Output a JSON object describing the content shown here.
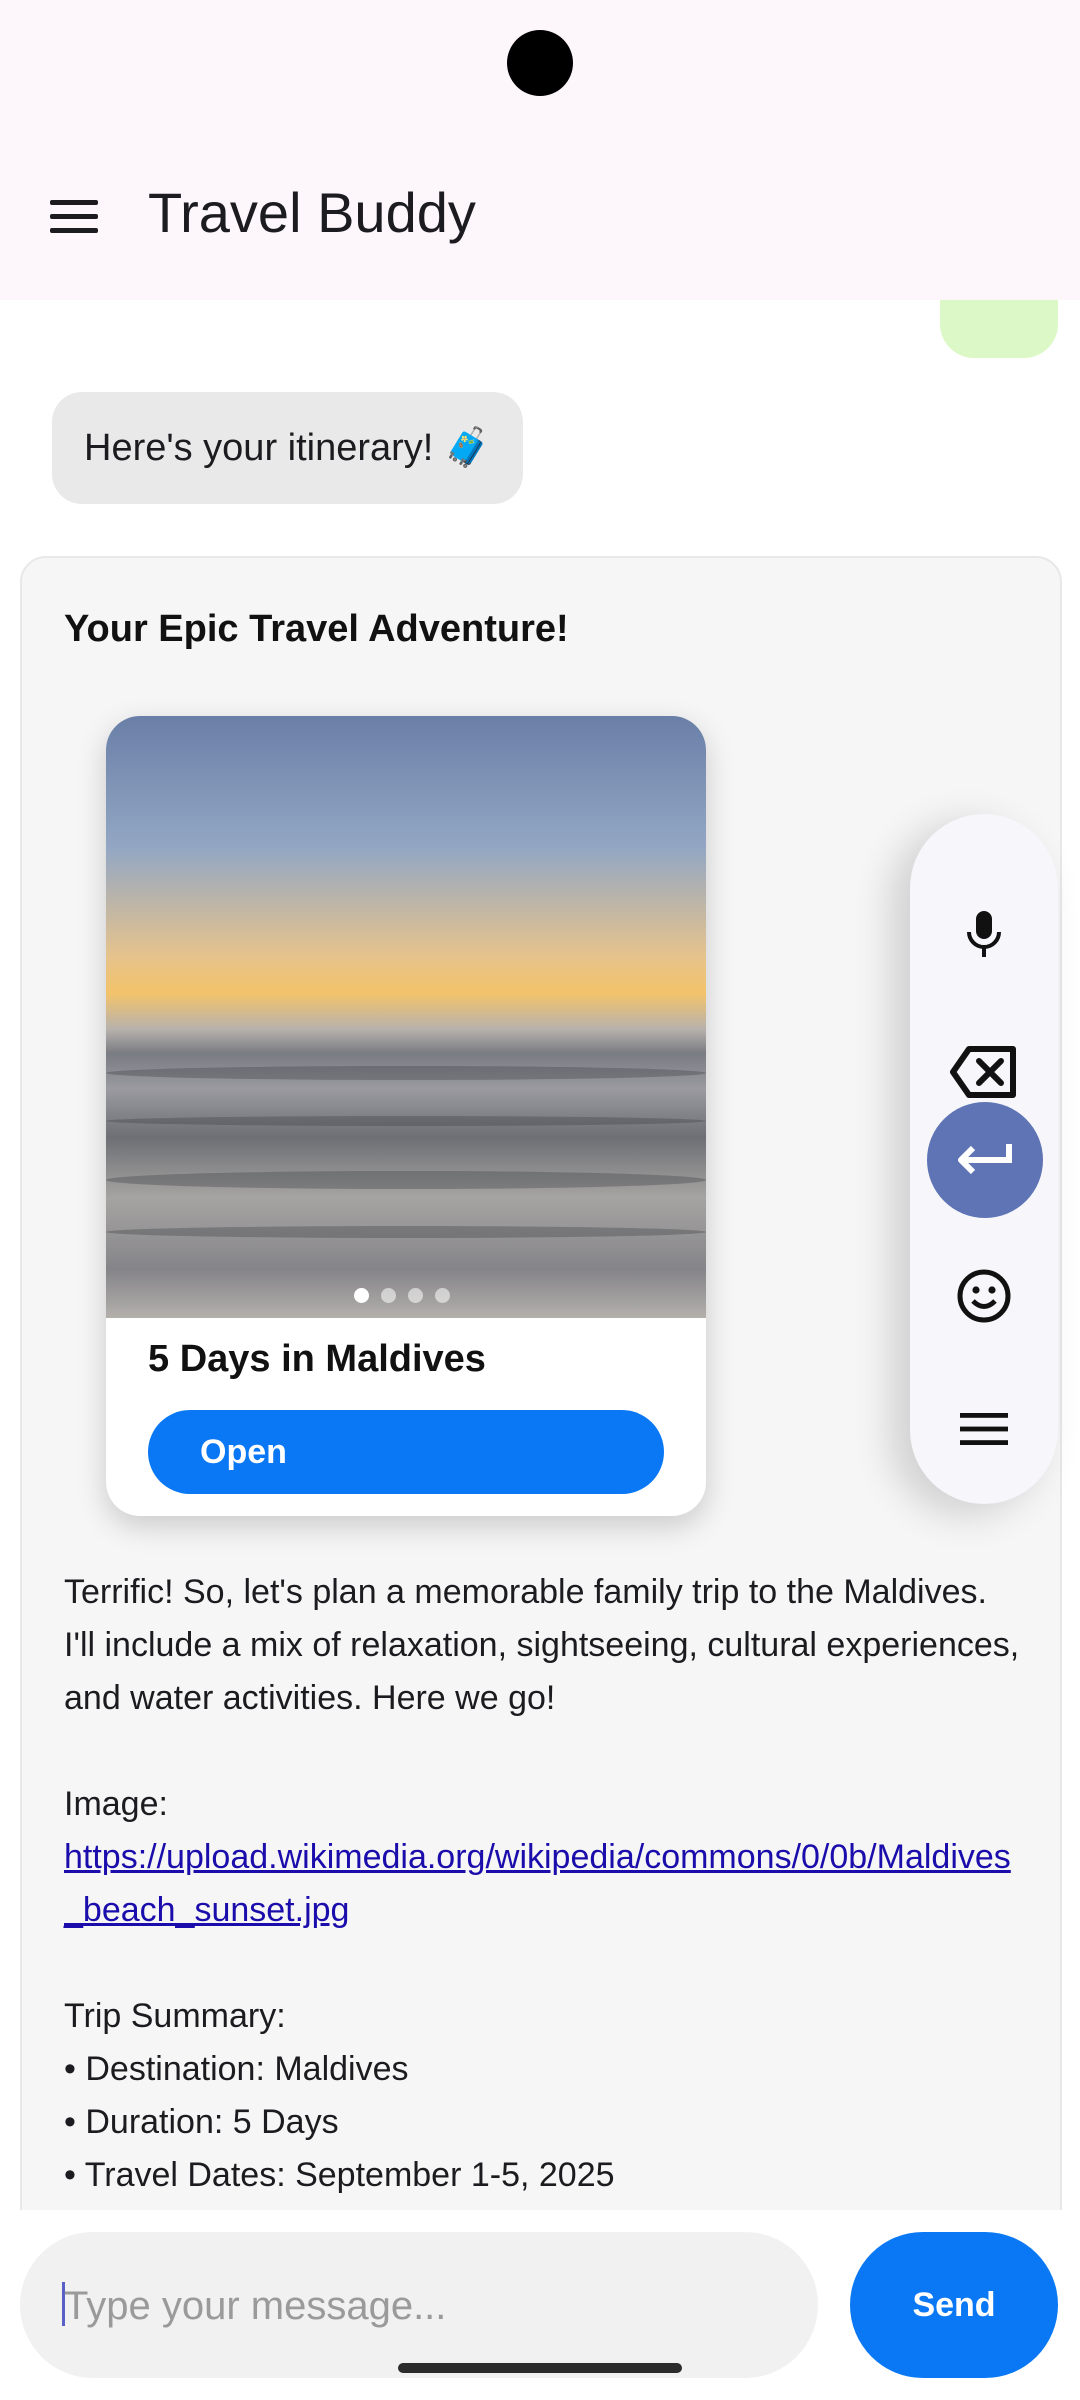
{
  "app_bar": {
    "title": "Travel Buddy",
    "menu_icon": "hamburger-menu-icon"
  },
  "messages": {
    "bot_intro": "Here's your itinerary! 🧳"
  },
  "itinerary_card": {
    "heading": "Your Epic Travel Adventure!",
    "trip": {
      "name": "5 Days in Maldives",
      "open_label": "Open",
      "image_pages": 4,
      "active_page": 1
    },
    "intro": "Terrific! So, let's plan a memorable family trip to the Maldives. I'll include a mix of relaxation, sightseeing, cultural experiences, and water activities. Here we go!",
    "image_label": "Image:",
    "image_url": "https://upload.wikimedia.org/wikipedia/commons/0/0b/Maldives_beach_sunset.jpg",
    "summary_heading": "Trip Summary:",
    "summary_items": [
      "• Destination: Maldives",
      "• Duration: 5 Days",
      "• Travel Dates: September 1-5, 2025"
    ]
  },
  "floating_toolbar": {
    "icons": [
      "microphone-icon",
      "backspace-icon",
      "enter-icon",
      "emoji-icon",
      "menu-icon"
    ]
  },
  "composer": {
    "placeholder": "Type your message...",
    "value": "",
    "send_label": "Send"
  },
  "colors": {
    "accent": "#0a78f5",
    "app_bar_bg": "#fdf7fb",
    "user_bubble": "#dcf8c6",
    "bot_bubble": "#e9e9e9",
    "card_bg": "#f6f6f6",
    "enter_key": "#5e74b4",
    "link": "#1a0dab"
  }
}
